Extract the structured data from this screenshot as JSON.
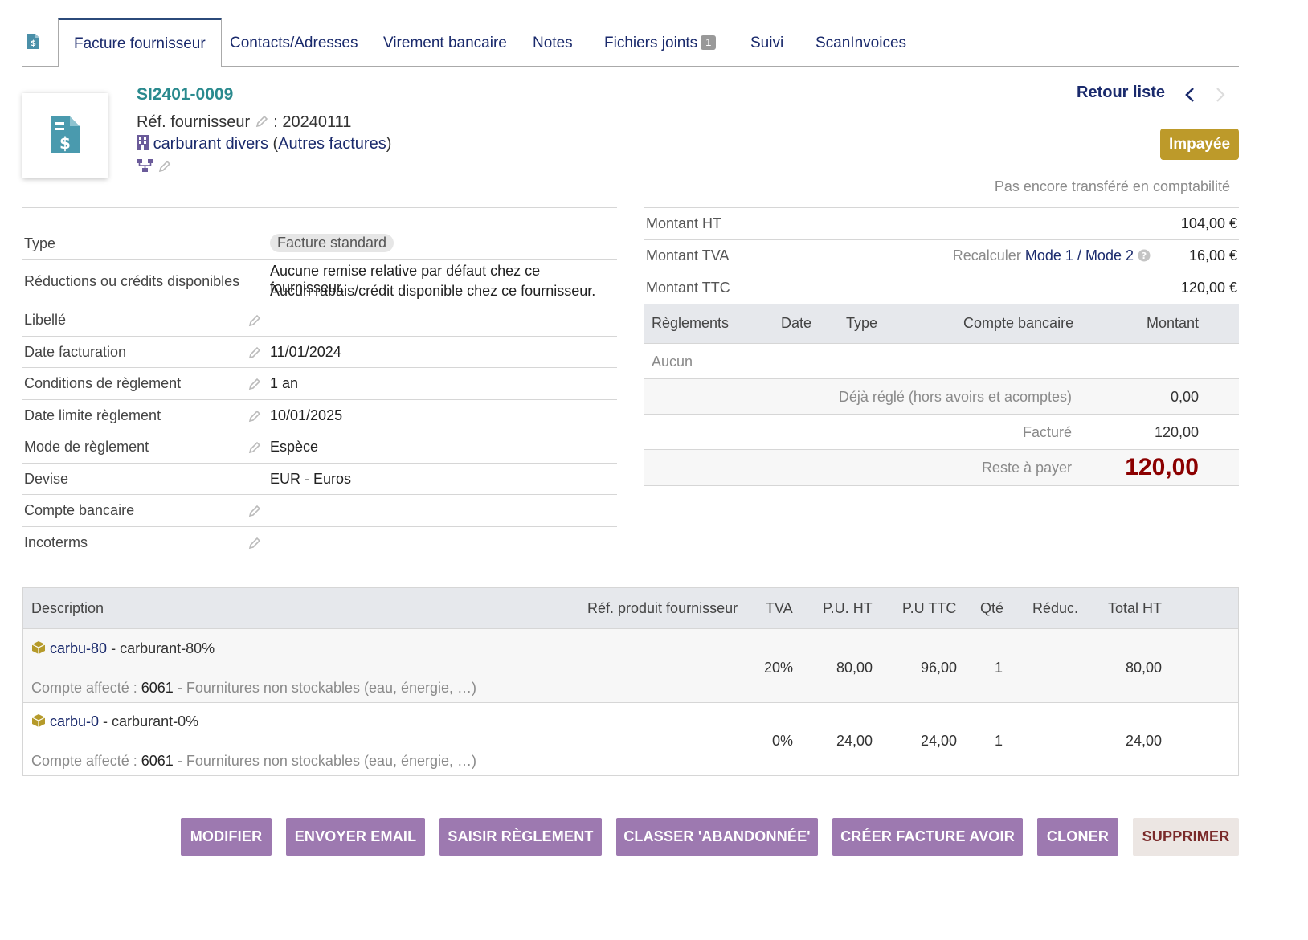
{
  "tabs": [
    {
      "label": "Facture fournisseur"
    },
    {
      "label": "Contacts/Adresses"
    },
    {
      "label": "Virement bancaire"
    },
    {
      "label": "Notes"
    },
    {
      "label": "Fichiers joints",
      "badge": "1"
    },
    {
      "label": "Suivi"
    },
    {
      "label": "ScanInvoices"
    }
  ],
  "header": {
    "ref": "SI2401-0009",
    "supplier_ref_label": "Réf. fournisseur",
    "supplier_ref_value": ": 20240111",
    "supplier_name": "carburant divers",
    "supplier_category_open": " (",
    "supplier_category": "Autres factures",
    "supplier_category_close": ")",
    "back_to_list": "Retour liste",
    "status": "Impayée",
    "accounting_status": "Pas encore transféré en comptabilité"
  },
  "info": {
    "type_label": "Type",
    "type_value": "Facture standard",
    "discounts_label": "Réductions ou crédits disponibles",
    "discounts_line1": "Aucune remise relative par défaut chez ce fournisseur.",
    "discounts_line2": "Aucun rabais/crédit disponible chez ce fournisseur.",
    "libelle_label": "Libellé",
    "date_label": "Date facturation",
    "date_value": "11/01/2024",
    "conditions_label": "Conditions de règlement",
    "conditions_value": "1 an",
    "due_label": "Date limite règlement",
    "due_value": "10/01/2025",
    "mode_label": "Mode de règlement",
    "mode_value": "Espèce",
    "currency_label": "Devise",
    "currency_value": "EUR - Euros",
    "bank_label": "Compte bancaire",
    "incoterms_label": "Incoterms"
  },
  "totals": {
    "ht_label": "Montant HT",
    "ht_value": "104,00 €",
    "tva_label": "Montant TVA",
    "recalc_label": "Recalculer",
    "mode1": "Mode 1",
    "slash": "/",
    "mode2": "Mode 2",
    "tva_value": "16,00 €",
    "ttc_label": "Montant TTC",
    "ttc_value": "120,00 €"
  },
  "payments": {
    "headers": [
      "Règlements",
      "Date",
      "Type",
      "Compte bancaire",
      "Montant"
    ],
    "empty": "Aucun",
    "already_paid_label": "Déjà réglé (hors avoirs et acomptes)",
    "already_paid_value": "0,00",
    "invoiced_label": "Facturé",
    "invoiced_value": "120,00",
    "remaining_label": "Reste à payer",
    "remaining_value": "120,00"
  },
  "lines": {
    "headers": {
      "description": "Description",
      "supplier_ref": "Réf. produit fournisseur",
      "tva": "TVA",
      "pu_ht": "P.U. HT",
      "pu_ttc": "P.U TTC",
      "qty": "Qté",
      "discount": "Réduc.",
      "total_ht": "Total HT"
    },
    "items": [
      {
        "code": "carbu-80",
        "sep": " - ",
        "name": "carburant-80%",
        "account_label": "Compte affecté :",
        "account_code": "6061",
        "account_dash": "-",
        "account_name": "Fournitures non stockables (eau, énergie, …)",
        "tva": "20%",
        "pu_ht": "80,00",
        "pu_ttc": "96,00",
        "qty": "1",
        "total_ht": "80,00"
      },
      {
        "code": "carbu-0",
        "sep": " - ",
        "name": "carburant-0%",
        "account_label": "Compte affecté :",
        "account_code": "6061",
        "account_dash": "-",
        "account_name": "Fournitures non stockables (eau, énergie, …)",
        "tva": "0%",
        "pu_ht": "24,00",
        "pu_ttc": "24,00",
        "qty": "1",
        "total_ht": "24,00"
      }
    ]
  },
  "actions": {
    "modify": "MODIFIER",
    "send_email": "ENVOYER EMAIL",
    "enter_payment": "SAISIR RÈGLEMENT",
    "classify_abandoned": "CLASSER 'ABANDONNÉE'",
    "create_credit_note": "CRÉER FACTURE AVOIR",
    "clone": "CLONER",
    "delete": "SUPPRIMER"
  },
  "colors": {
    "accent": "#2a8a8e",
    "status": "#bd9a2a",
    "button": "#9d79b0",
    "remaining": "#8b0000",
    "link": "#1a2a6c"
  }
}
